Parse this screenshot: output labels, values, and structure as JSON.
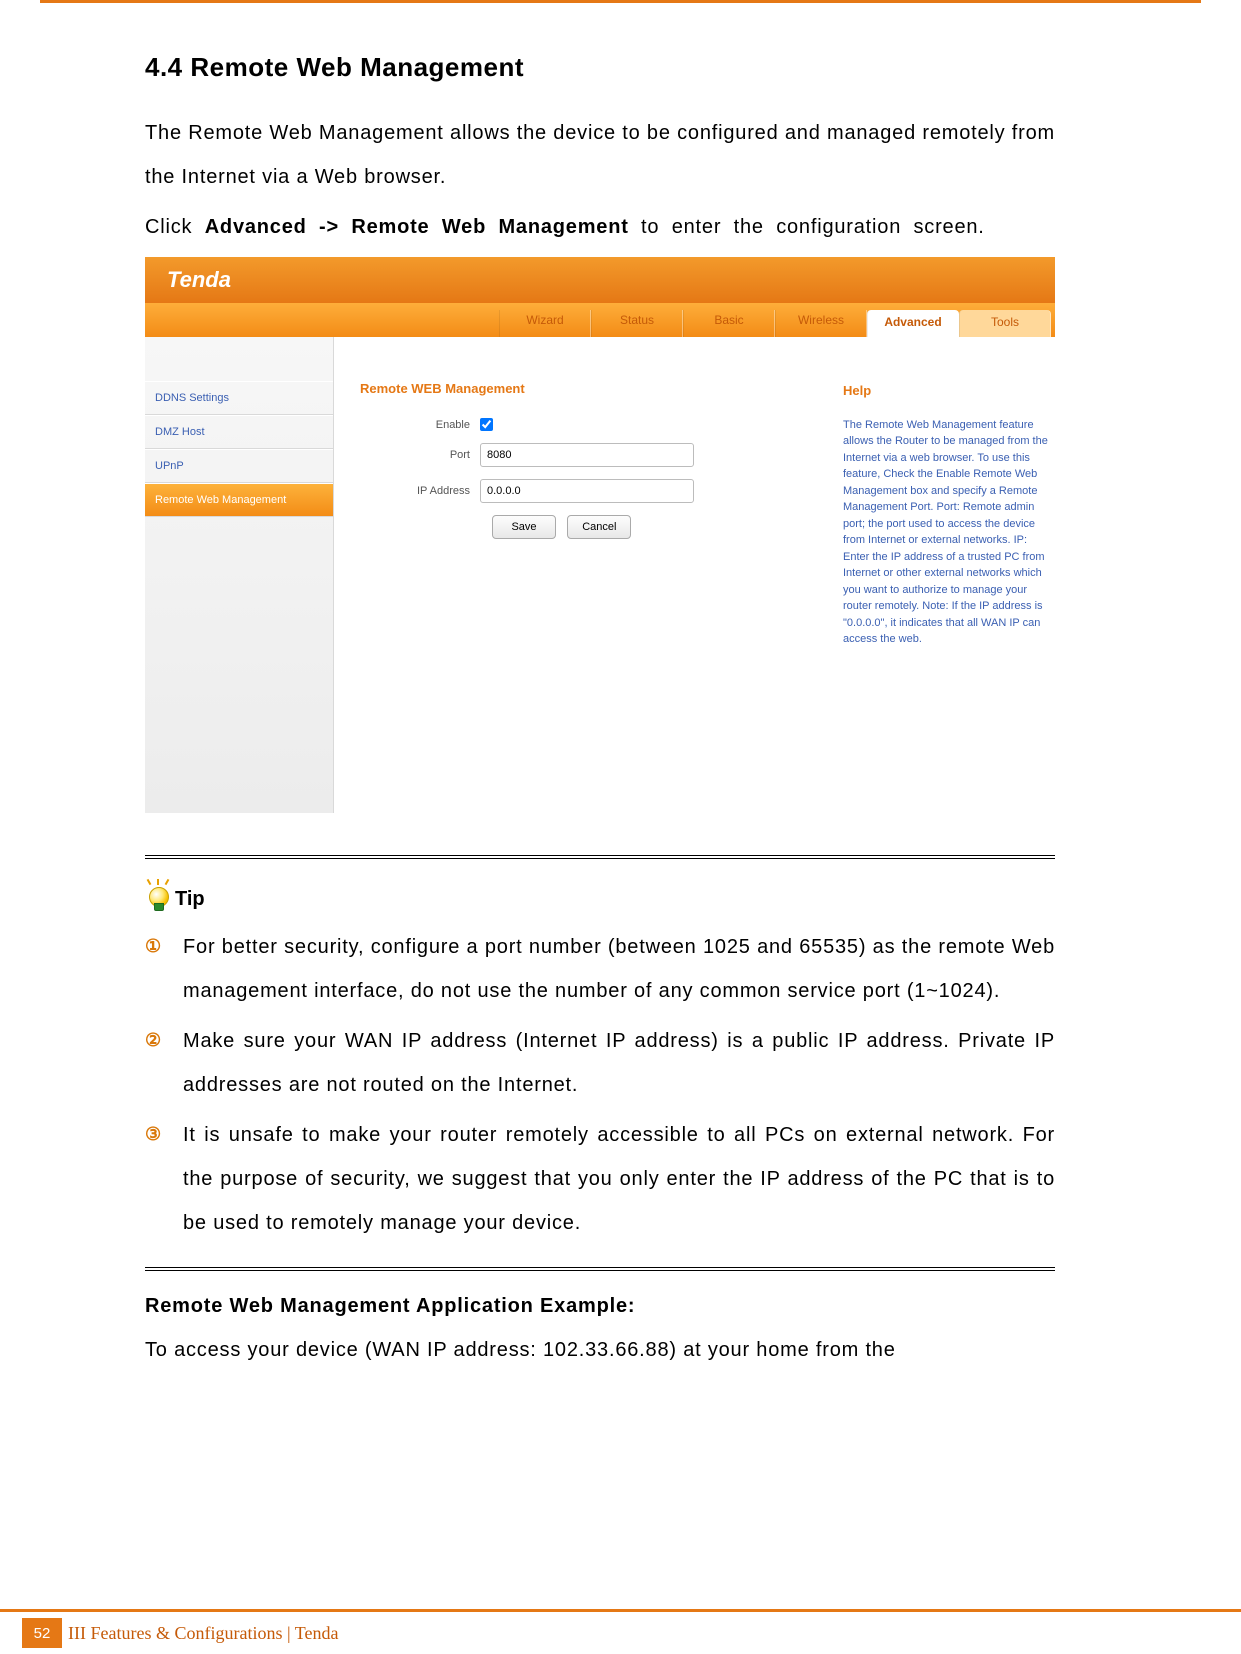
{
  "section": {
    "title": "4.4 Remote Web Management",
    "para1": "The Remote Web Management allows the device to be configured and managed remotely from the Internet via a Web browser.",
    "para2_pre": "Click ",
    "para2_strong": "Advanced -> Remote Web Management",
    "para2_post": " to enter the configuration screen."
  },
  "screenshot": {
    "logo": "Tenda",
    "tabs": {
      "wizard": "Wizard",
      "status": "Status",
      "basic": "Basic",
      "wireless": "Wireless",
      "advanced": "Advanced",
      "tools": "Tools"
    },
    "sidebar": {
      "ddns": "DDNS Settings",
      "dmz": "DMZ Host",
      "upnp": "UPnP",
      "remote": "Remote Web Management"
    },
    "main": {
      "title": "Remote WEB Management",
      "labels": {
        "enable": "Enable",
        "port": "Port",
        "ip": "IP Address"
      },
      "values": {
        "enable": true,
        "port": "8080",
        "ip": "0.0.0.0"
      },
      "buttons": {
        "save": "Save",
        "cancel": "Cancel"
      }
    },
    "help": {
      "title": "Help",
      "text": "The Remote Web Management feature allows the Router to be managed from the Internet via a web browser. To use this feature, Check the Enable Remote Web Management box and specify a Remote Management Port. Port: Remote admin port; the port used to access the device from Internet or external networks. IP: Enter the IP address of a trusted PC from Internet or other external networks which you want to authorize to manage your router remotely. Note: If the IP address is \"0.0.0.0\", it indicates that all WAN IP can access the web."
    }
  },
  "tip": {
    "label": "Tip",
    "items": [
      {
        "num": "①",
        "text": "For better security, configure a port number (between 1025 and 65535) as the remote Web management interface, do not use the number of any common service port (1~1024)."
      },
      {
        "num": "②",
        "text": "Make sure your WAN IP address (Internet IP address) is a public IP address. Private IP addresses are not routed on the Internet."
      },
      {
        "num": "③",
        "text": "It is unsafe to make your router remotely accessible to all PCs on external network. For the purpose of security, we suggest that you only enter the IP address of the PC that is to be used to remotely manage your device."
      }
    ]
  },
  "example": {
    "heading": "Remote Web Management Application Example:",
    "text": "To access your device (WAN IP address: 102.33.66.88) at your home from the"
  },
  "footer": {
    "page": "52",
    "text": "III Features & Configurations | Tenda"
  }
}
